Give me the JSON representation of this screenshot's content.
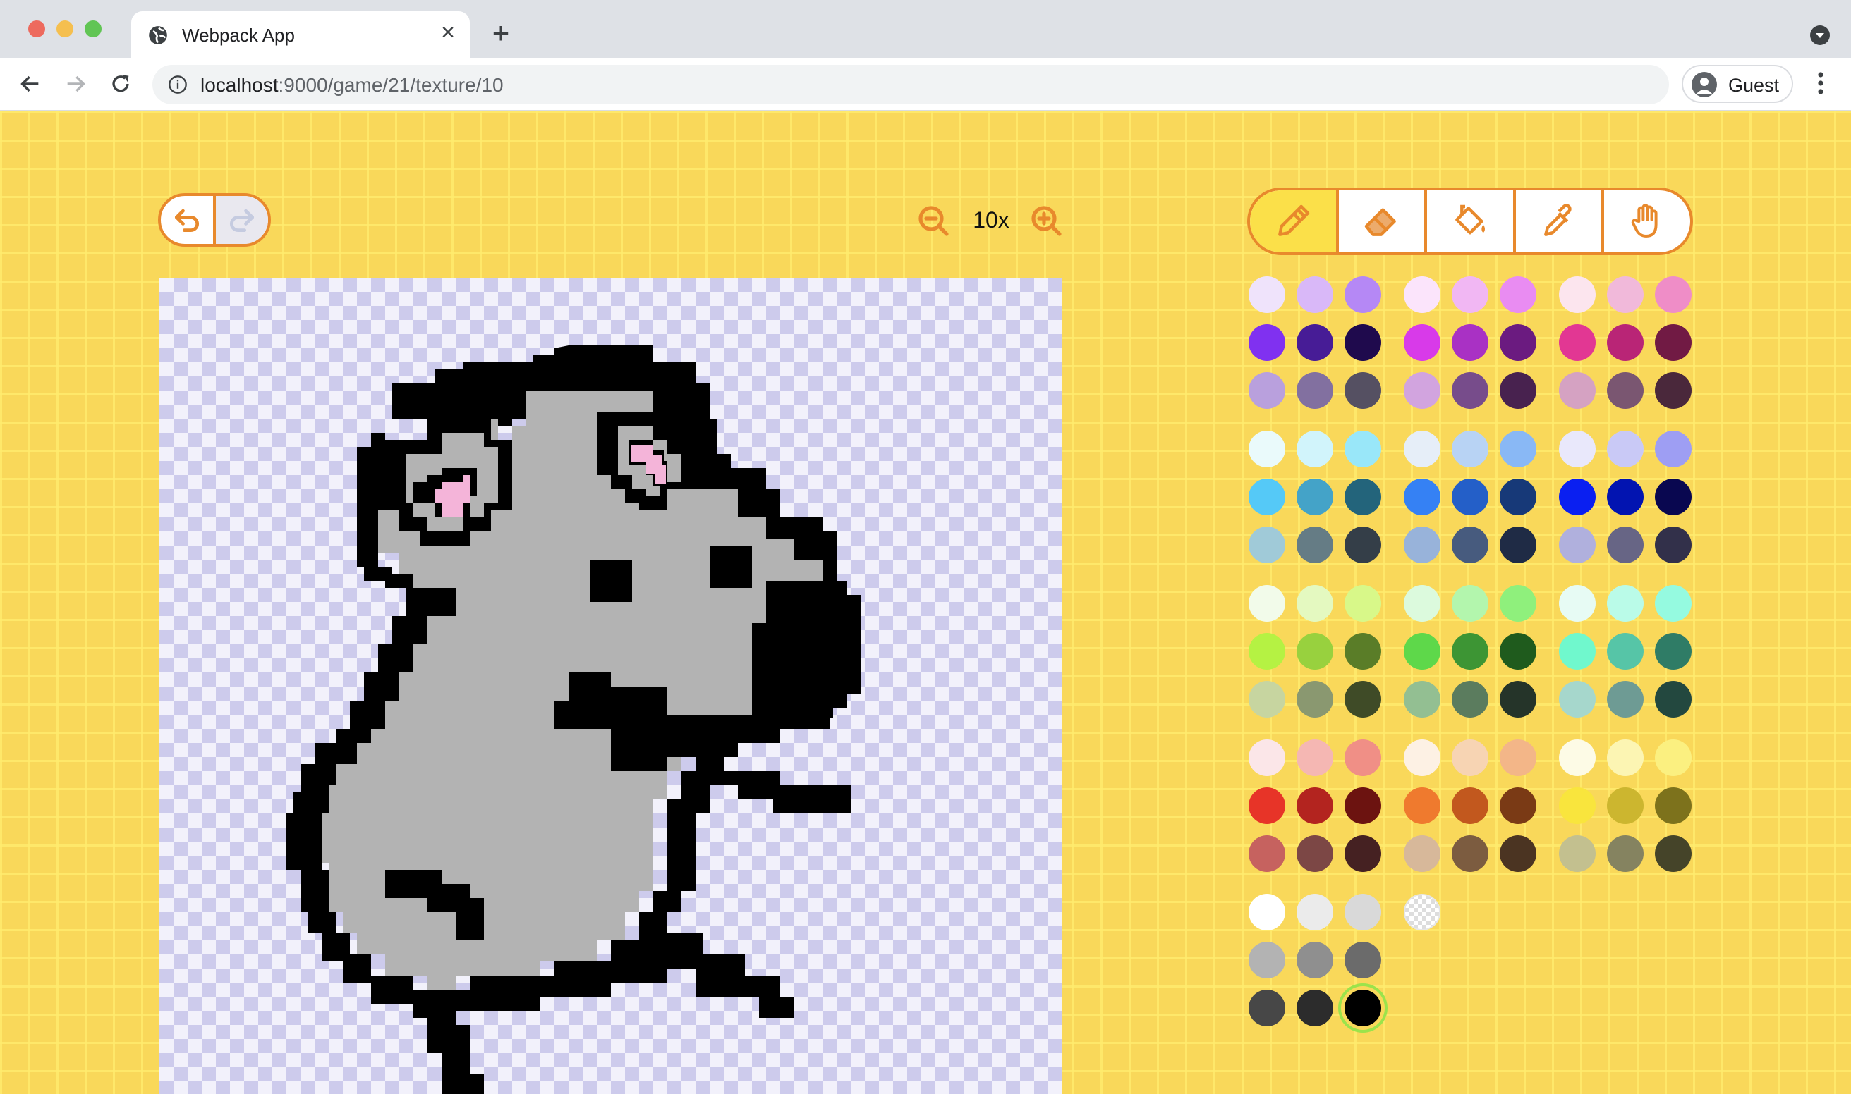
{
  "browser": {
    "tab_title": "Webpack App",
    "url_host": "localhost",
    "url_path": ":9000/game/21/texture/10",
    "profile_label": "Guest"
  },
  "editor": {
    "zoom_label": "10x",
    "tools": [
      {
        "name": "pencil",
        "active": true
      },
      {
        "name": "eraser",
        "active": false
      },
      {
        "name": "fill-bucket",
        "active": false
      },
      {
        "name": "eyedropper",
        "active": false
      },
      {
        "name": "hand",
        "active": false
      }
    ],
    "accent_color": "#e8892c",
    "active_tool_color": "#fbe049",
    "palette": {
      "selected": "#000000",
      "groups": [
        [
          [
            "#efe3fb",
            "#d9b8f8",
            "#b588f5"
          ],
          [
            "#8031f0",
            "#471c96",
            "#1f0a4d"
          ],
          [
            "#b9a0dd",
            "#8270a0",
            "#555062"
          ]
        ],
        [
          [
            "#fbe4fb",
            "#f1b7f3",
            "#e98cf2"
          ],
          [
            "#d83ae9",
            "#a931c4",
            "#6b1b80"
          ],
          [
            "#d2a4df",
            "#774c8b",
            "#48224f"
          ]
        ],
        [
          [
            "#fce5ee",
            "#f1b9da",
            "#ef8dc7"
          ],
          [
            "#e23793",
            "#b92576",
            "#711a44"
          ],
          [
            "#d5a2c2",
            "#7a5671",
            "#4a283b"
          ]
        ],
        [
          [
            "#eafafb",
            "#d1f4fb",
            "#99e7f9"
          ],
          [
            "#55c9f7",
            "#44a3c8",
            "#23647b"
          ],
          [
            "#a0cad8",
            "#657c85",
            "#343e48"
          ]
        ],
        [
          [
            "#e6eef8",
            "#b8d3f4",
            "#89b8f5"
          ],
          [
            "#3581f4",
            "#245fc8",
            "#173978"
          ],
          [
            "#98b3da",
            "#475b7e",
            "#1f2b45"
          ]
        ],
        [
          [
            "#e9e8fb",
            "#c9c9f6",
            "#9e9ef3"
          ],
          [
            "#0a1ff1",
            "#0214b1",
            "#090750"
          ],
          [
            "#b0b0dd",
            "#676585",
            "#32304a"
          ]
        ],
        [
          [
            "#f2fbea",
            "#e4f9c0",
            "#d8f889"
          ],
          [
            "#b5f243",
            "#98d13e",
            "#5a7d28"
          ],
          [
            "#c7d5a0",
            "#8a9870",
            "#3f4b27"
          ]
        ],
        [
          [
            "#dcfadd",
            "#b3f6ad",
            "#8ff07c"
          ],
          [
            "#5ed84a",
            "#3d9534",
            "#1f5b1d"
          ],
          [
            "#93bf92",
            "#5b7c5e",
            "#253429"
          ]
        ],
        [
          [
            "#e7fbf4",
            "#bafbe8",
            "#95fae0"
          ],
          [
            "#70f8cd",
            "#56c5a7",
            "#2f7c66"
          ],
          [
            "#a6d7cc",
            "#6e9b94",
            "#23483f"
          ]
        ],
        [
          [
            "#fbe6e8",
            "#f5b7b3",
            "#f08f86"
          ],
          [
            "#e73428",
            "#b3241f",
            "#6c1310"
          ],
          [
            "#c6625f",
            "#7c4745",
            "#452122"
          ]
        ],
        [
          [
            "#fdf1e4",
            "#f7d4b3",
            "#f3b688"
          ],
          [
            "#ef7a2e",
            "#c2581e",
            "#7a3a15"
          ],
          [
            "#d7b89a",
            "#7c5c40",
            "#4b3422"
          ]
        ],
        [
          [
            "#fdfbe6",
            "#fcf5b3",
            "#fbf080"
          ],
          [
            "#f9e53d",
            "#ccb62f",
            "#7d721c"
          ],
          [
            "#c3c08f",
            "#858360",
            "#454429"
          ]
        ],
        [
          [
            "#ffffff",
            "#ebebeb",
            "#d9d9d9"
          ],
          [
            "#b3b3b3",
            "#8f8f8f",
            "#6b6b6b"
          ],
          [
            "#474747",
            "#2c2c2c",
            "#000000"
          ]
        ],
        [
          [
            "transparent"
          ]
        ]
      ]
    }
  }
}
